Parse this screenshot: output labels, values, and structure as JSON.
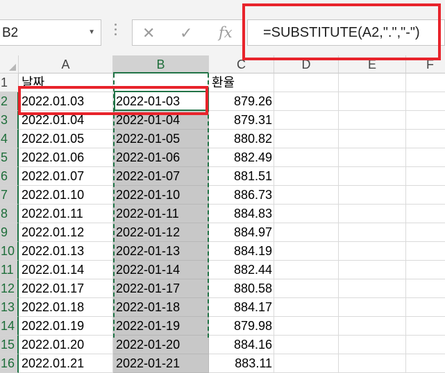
{
  "name_box": {
    "value": "B2"
  },
  "formula_bar": {
    "cancel_glyph": "✕",
    "enter_glyph": "✓",
    "function_glyph": "fx",
    "formula": "=SUBSTITUTE(A2,\".\",\"-\")"
  },
  "columns": [
    "A",
    "B",
    "C",
    "D",
    "E",
    "F"
  ],
  "rows": [
    {
      "num": "1",
      "a": "날짜",
      "b": "",
      "c": "환율"
    },
    {
      "num": "2",
      "a": "2022.01.03",
      "b": "2022-01-03",
      "c": "879.26"
    },
    {
      "num": "3",
      "a": "2022.01.04",
      "b": "2022-01-04",
      "c": "879.31"
    },
    {
      "num": "4",
      "a": "2022.01.05",
      "b": "2022-01-05",
      "c": "880.82"
    },
    {
      "num": "5",
      "a": "2022.01.06",
      "b": "2022-01-06",
      "c": "882.49"
    },
    {
      "num": "6",
      "a": "2022.01.07",
      "b": "2022-01-07",
      "c": "881.51"
    },
    {
      "num": "7",
      "a": "2022.01.10",
      "b": "2022-01-10",
      "c": "886.73"
    },
    {
      "num": "8",
      "a": "2022.01.11",
      "b": "2022-01-11",
      "c": "884.83"
    },
    {
      "num": "9",
      "a": "2022.01.12",
      "b": "2022-01-12",
      "c": "884.97"
    },
    {
      "num": "10",
      "a": "2022.01.13",
      "b": "2022-01-13",
      "c": "884.19"
    },
    {
      "num": "11",
      "a": "2022.01.14",
      "b": "2022-01-14",
      "c": "882.44"
    },
    {
      "num": "12",
      "a": "2022.01.17",
      "b": "2022-01-17",
      "c": "880.58"
    },
    {
      "num": "13",
      "a": "2022.01.18",
      "b": "2022-01-18",
      "c": "884.17"
    },
    {
      "num": "14",
      "a": "2022.01.19",
      "b": "2022-01-19",
      "c": "879.98"
    },
    {
      "num": "15",
      "a": "2022.01.20",
      "b": "2022-01-20",
      "c": "884.16"
    },
    {
      "num": "16",
      "a": "2022.01.21",
      "b": "2022-01-21",
      "c": "883.11"
    }
  ],
  "colors": {
    "selection_green": "#217346",
    "highlight_red": "#e8232b",
    "selection_shade": "#c8c8c8"
  }
}
